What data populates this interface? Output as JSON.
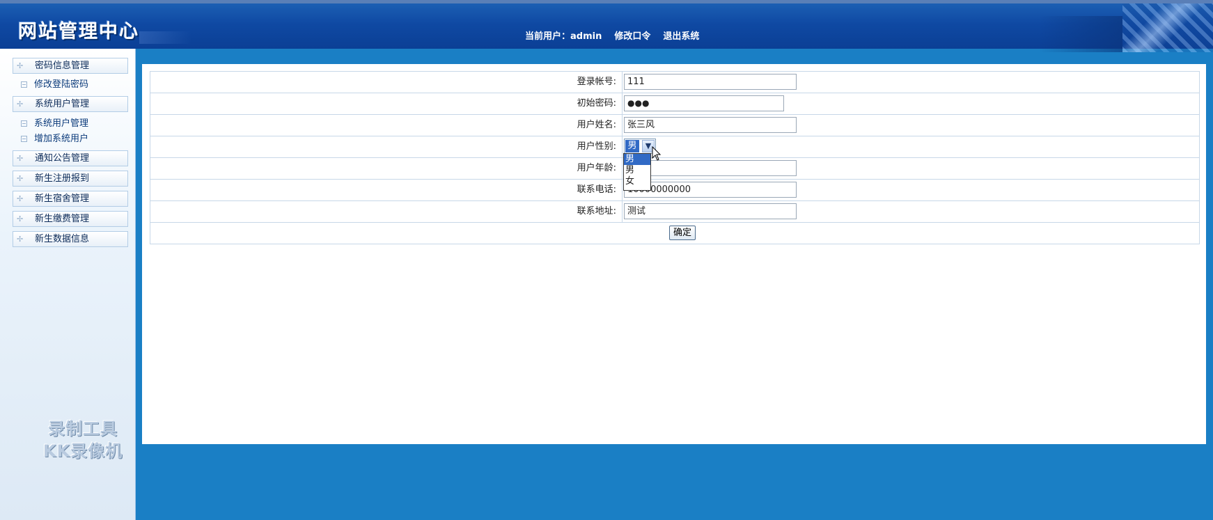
{
  "header": {
    "title": "网站管理中心",
    "current_user": "当前用户：admin",
    "change_password": "修改口令",
    "logout": "退出系统"
  },
  "sidebar": {
    "items": [
      {
        "label": "密码信息管理",
        "type": "group"
      },
      {
        "label": "修改登陆密码",
        "type": "sub"
      },
      {
        "label": "系统用户管理",
        "type": "group"
      },
      {
        "label": "系统用户管理",
        "type": "sub"
      },
      {
        "label": "增加系统用户",
        "type": "sub"
      },
      {
        "label": "通知公告管理",
        "type": "group"
      },
      {
        "label": "新生注册报到",
        "type": "group"
      },
      {
        "label": "新生宿舍管理",
        "type": "group"
      },
      {
        "label": "新生缴费管理",
        "type": "group"
      },
      {
        "label": "新生数据信息",
        "type": "group"
      }
    ],
    "watermark_line1": "录制工具",
    "watermark_line2": "KK录像机"
  },
  "form": {
    "fields": [
      {
        "label": "登录帐号:",
        "value": "111"
      },
      {
        "label": "初始密码:",
        "value": "●●●"
      },
      {
        "label": "用户姓名:",
        "value": "张三风"
      },
      {
        "label": "用户性别:",
        "value": "男"
      },
      {
        "label": "用户年龄:",
        "value": ""
      },
      {
        "label": "联系电话:",
        "value": "10000000000"
      },
      {
        "label": "联系地址:",
        "value": "测试"
      }
    ],
    "gender_options": [
      "男",
      "男",
      "女"
    ],
    "submit_label": "确定"
  }
}
